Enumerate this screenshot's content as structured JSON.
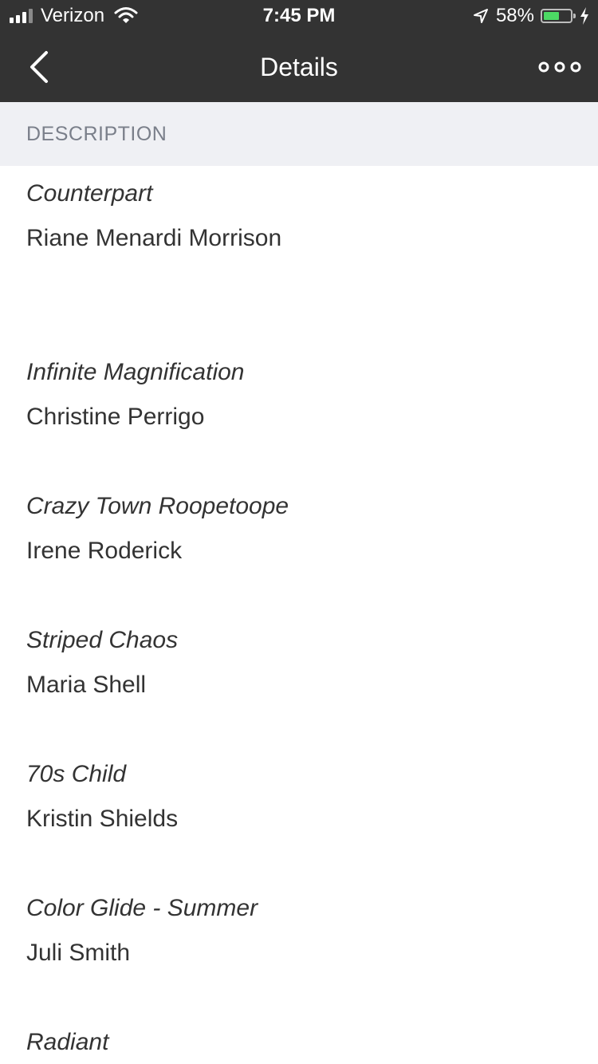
{
  "status_bar": {
    "carrier": "Verizon",
    "time": "7:45 PM",
    "battery_percent": "58%",
    "battery_level": 0.58,
    "signal_bars": 3,
    "signal_total": 4
  },
  "nav": {
    "title": "Details",
    "back_icon": "chevron-left-icon",
    "more_icon": "more-horizontal-icon"
  },
  "section": {
    "label": "DESCRIPTION"
  },
  "entries": [
    {
      "title": "Counterpart",
      "artist": "Riane Menardi Morrison"
    },
    {
      "title": "Infinite Magnification",
      "artist": "Christine Perrigo"
    },
    {
      "title": "Crazy Town Roopetoope",
      "artist": "Irene Roderick"
    },
    {
      "title": "Striped Chaos",
      "artist": "Maria Shell"
    },
    {
      "title": "70s Child",
      "artist": "Kristin Shields"
    },
    {
      "title": "Color Glide - Summer",
      "artist": "Juli Smith"
    },
    {
      "title": "Radiant",
      "artist": ""
    }
  ],
  "colors": {
    "nav_background": "#333333",
    "section_background": "#eff0f4",
    "battery_fill": "#4cd964"
  }
}
